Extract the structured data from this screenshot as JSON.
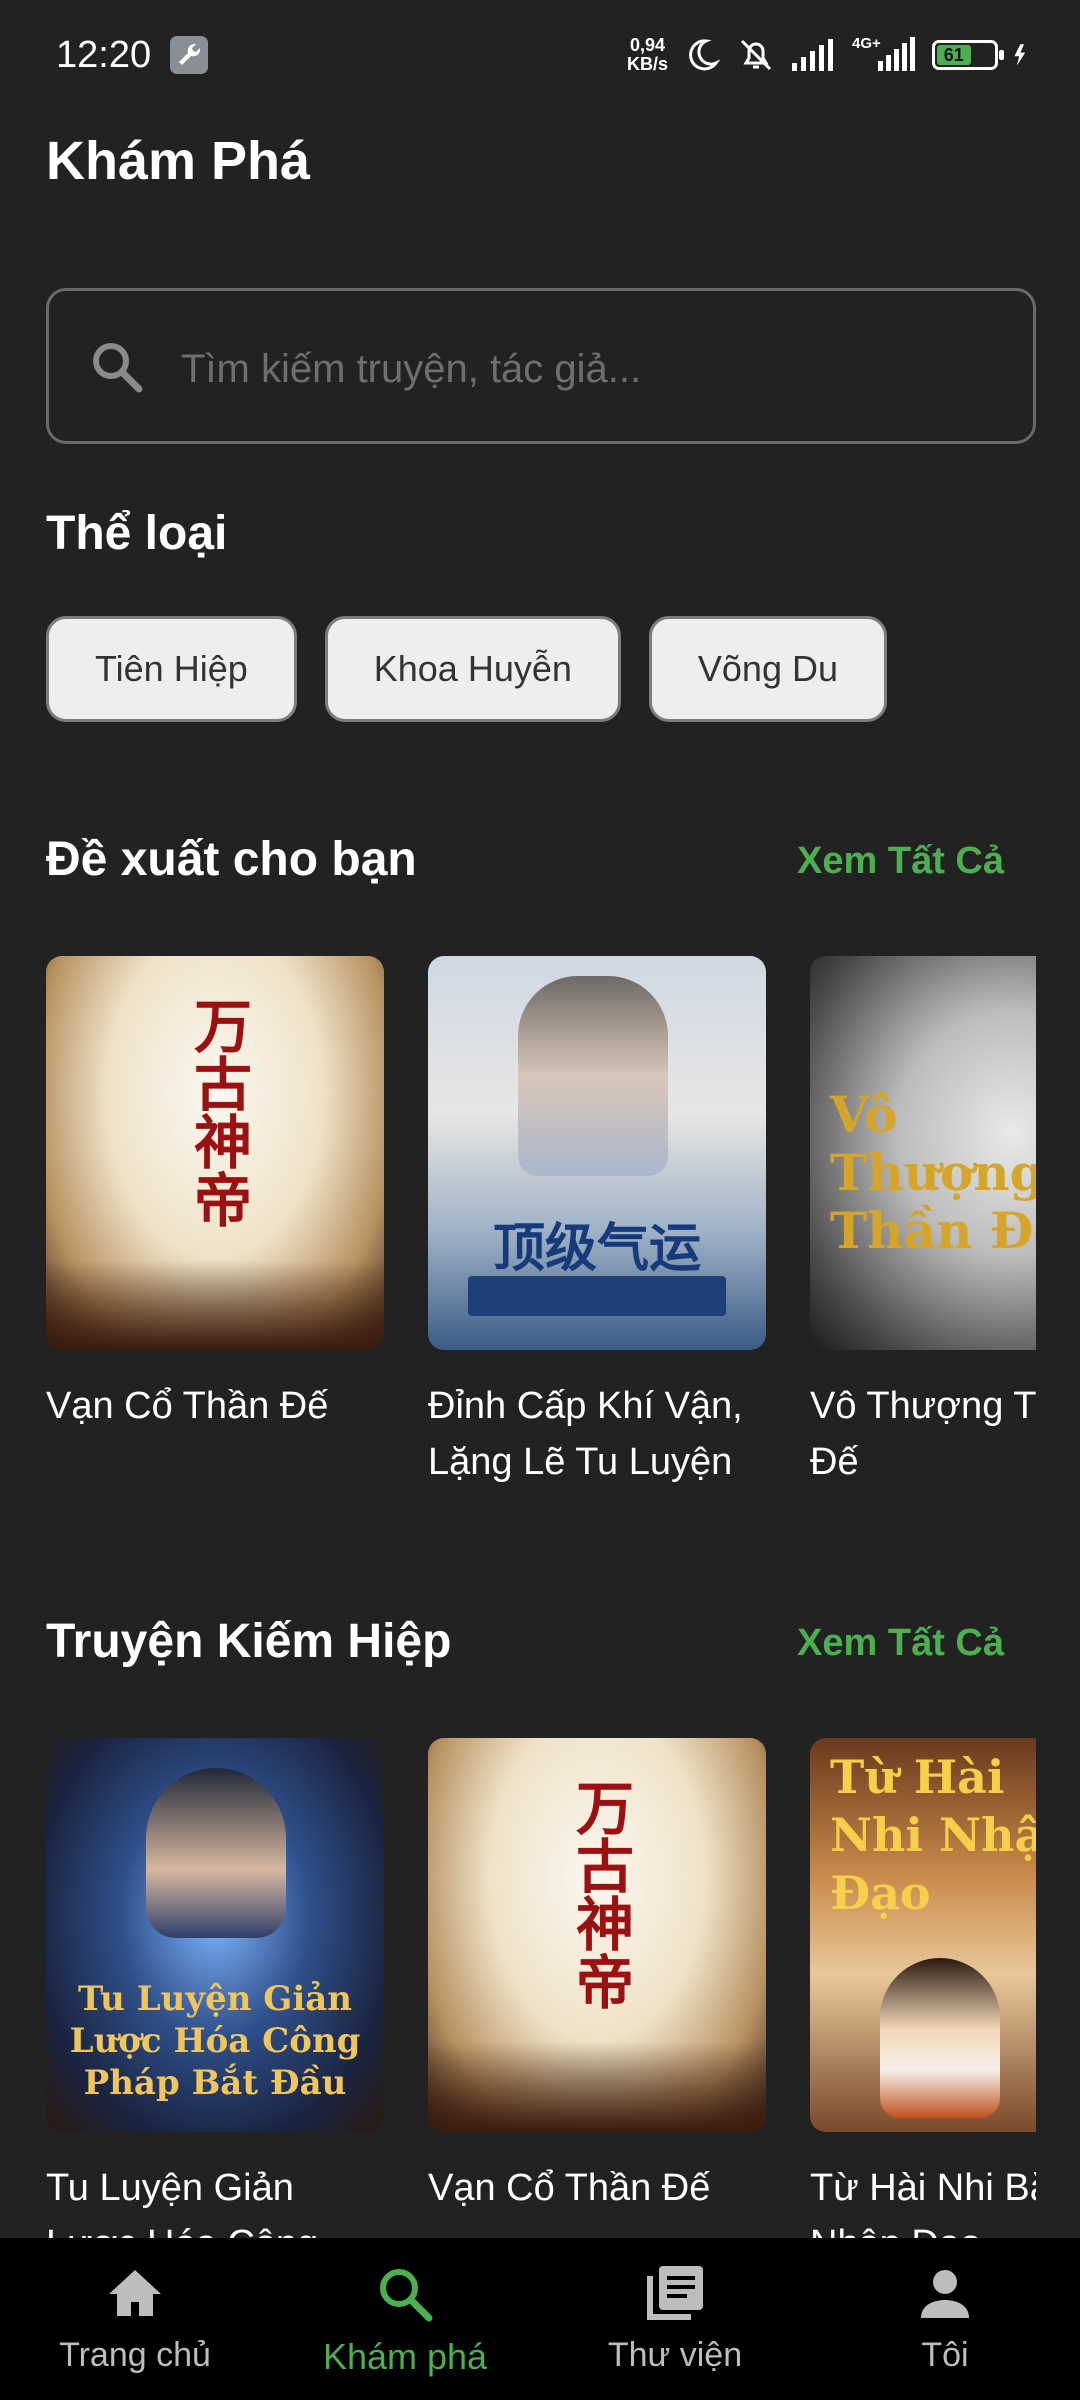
{
  "status": {
    "time": "12:20",
    "netspeed_value": "0,94",
    "netspeed_unit": "KB/s",
    "network": "4G+",
    "battery": "61"
  },
  "header": {
    "title": "Khám Phá"
  },
  "search": {
    "placeholder": "Tìm kiếm truyện, tác giả..."
  },
  "genres": {
    "title": "Thể loại",
    "items": [
      "Tiên Hiệp",
      "Khoa Huyễn",
      "Võng Du"
    ]
  },
  "recommended": {
    "title": "Đề xuất cho bạn",
    "see_all": "Xem Tất Cả",
    "books": [
      {
        "title": "Vạn Cổ Thần Đế",
        "cover_text": "万古神帝"
      },
      {
        "title": "Đỉnh Cấp Khí Vận, Lặng Lẽ Tu Luyện Ngàn Năm",
        "cover_text": "顶级气运"
      },
      {
        "title": "Vô Thượng Thần Đế",
        "cover_text": "Vô Thượng Thần Đế"
      }
    ]
  },
  "kiemhiep": {
    "title": "Truyện Kiếm Hiệp",
    "see_all": "Xem Tất Cả",
    "books": [
      {
        "title": "Tu Luyện Giản Lược Hóa Công Pháp",
        "cover_text": "Tu Luyện Giản Lược Hóa Công Pháp Bắt Đầu"
      },
      {
        "title": "Vạn Cổ Thần Đế",
        "cover_text": "万古神帝"
      },
      {
        "title": "Từ Hài Nhi Bắt Đầu Nhập Đạo",
        "cover_text": "Từ Hài Nhi Nhập Đạo"
      }
    ]
  },
  "nav": [
    {
      "label": "Trang chủ",
      "icon": "home-icon"
    },
    {
      "label": "Khám phá",
      "icon": "search-icon"
    },
    {
      "label": "Thư viện",
      "icon": "library-icon"
    },
    {
      "label": "Tôi",
      "icon": "person-icon"
    }
  ],
  "colors": {
    "background": "#222222",
    "accent": "#4caf50",
    "chip_bg": "#eeeeee"
  }
}
